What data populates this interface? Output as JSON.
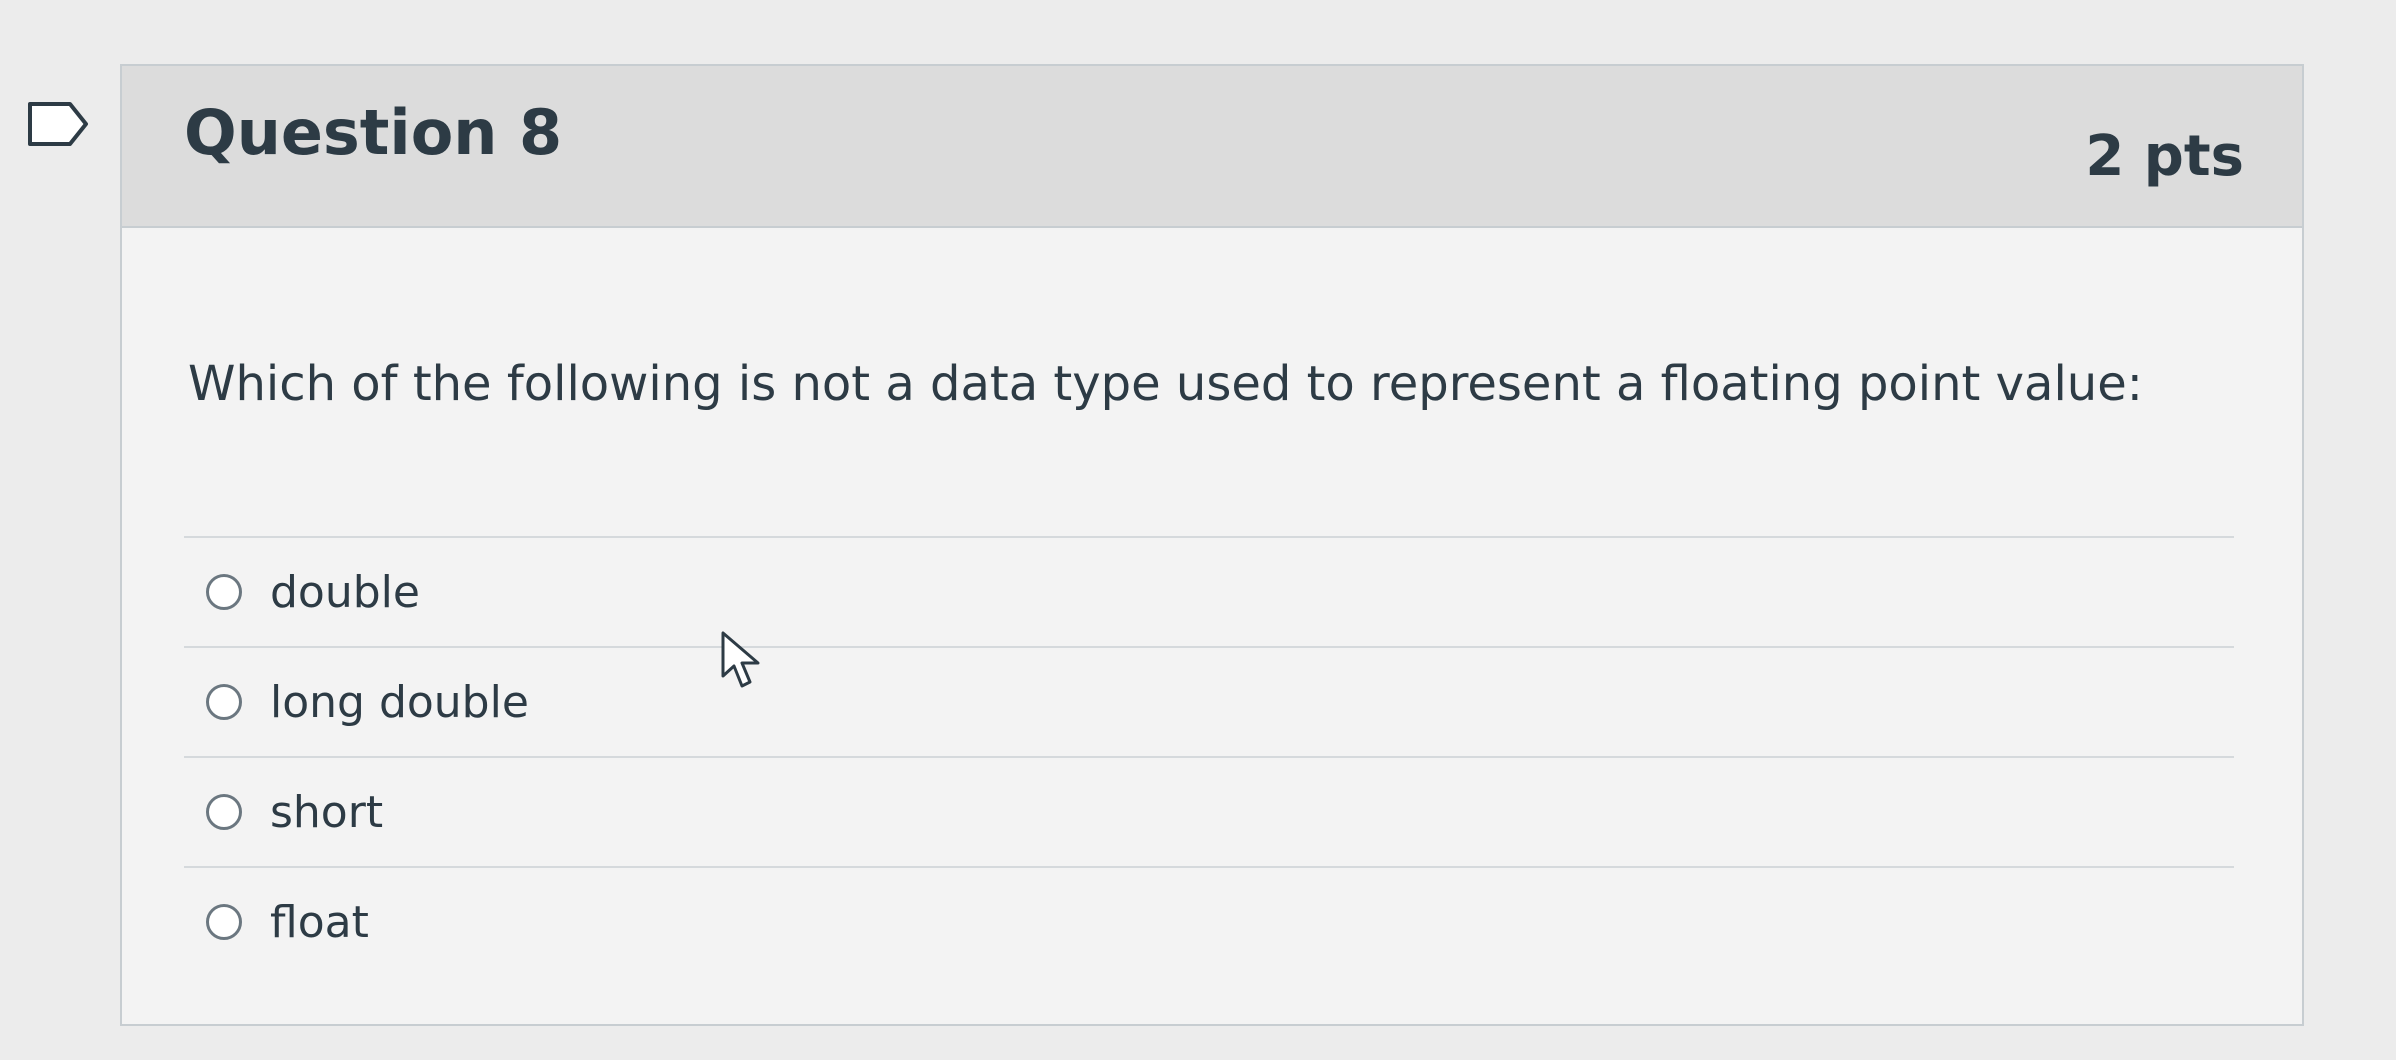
{
  "question": {
    "title": "Question 8",
    "points": "2 pts",
    "text": "Which of the following is not a data type used to represent a floating point value:"
  },
  "answers": [
    {
      "label": "double"
    },
    {
      "label": "long double"
    },
    {
      "label": "short"
    },
    {
      "label": "float"
    }
  ],
  "icons": {
    "flag": "flag-question-icon",
    "cursor": "mouse-pointer-icon"
  }
}
